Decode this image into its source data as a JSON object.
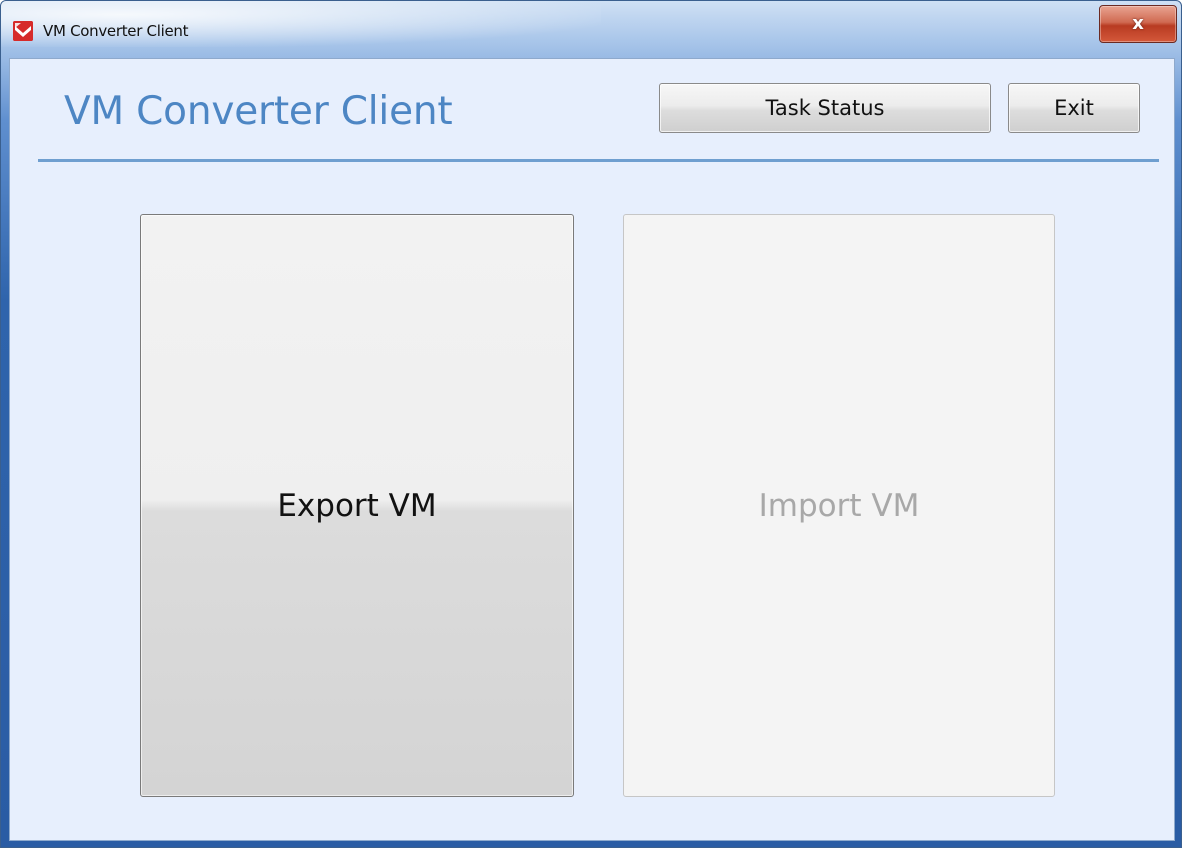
{
  "window": {
    "title": "VM Converter Client",
    "close_label": "x"
  },
  "header": {
    "app_title": "VM Converter Client",
    "task_status_label": "Task Status",
    "exit_label": "Exit"
  },
  "actions": {
    "export_label": "Export VM",
    "import_label": "Import VM",
    "import_enabled": false
  },
  "colors": {
    "title_text": "#4d86c4",
    "rule": "#6f9fd0",
    "client_background": "#e7effd",
    "disabled_text": "#a8a8a8"
  },
  "icons": {
    "app": "vm-converter-app-icon",
    "close": "close-icon"
  }
}
